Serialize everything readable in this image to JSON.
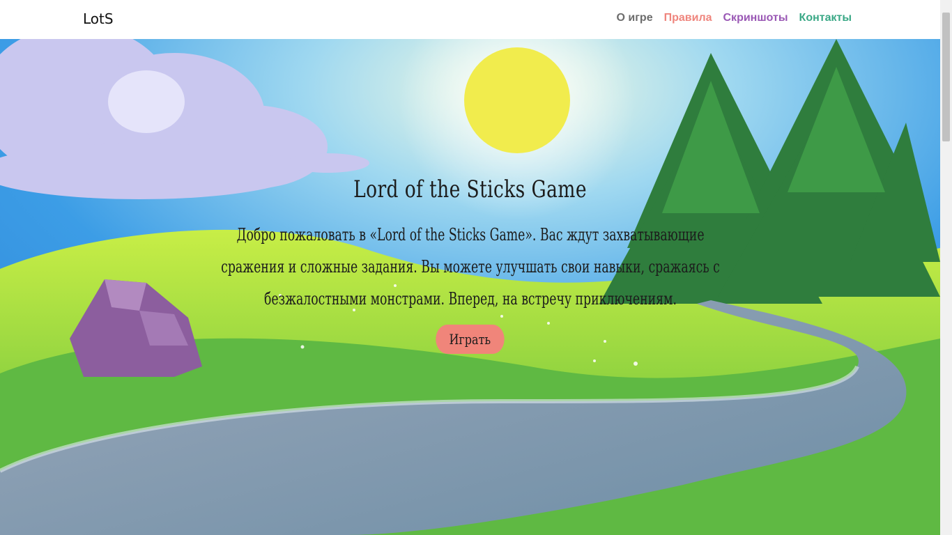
{
  "brand": "LotS",
  "nav": {
    "about": "О игре",
    "rules": "Правила",
    "screenshots": "Скриншоты",
    "contacts": "Контакты"
  },
  "colors": {
    "about": "#6c6c6c",
    "rules": "#ef857d",
    "screenshots": "#9a58b5",
    "contacts": "#3aa886",
    "button": "#f0857a"
  },
  "hero": {
    "title": "Lord of the Sticks Game",
    "text": "Добро пожаловать в «Lord of the Sticks Game». Вас ждут захватывающие сражения и сложные задания. Вы можете улучшать свои навыки, сражаясь с безжалостными монстрами. Вперед, на встречу приключениям.",
    "button": "Играть"
  }
}
